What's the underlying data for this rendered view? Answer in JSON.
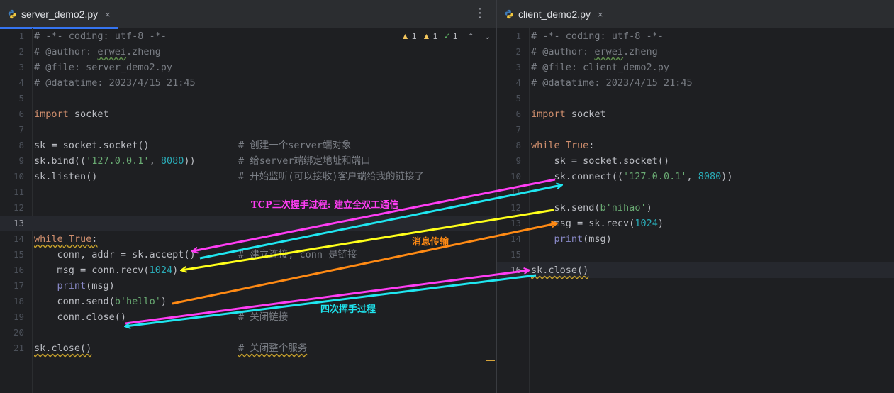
{
  "left_tab": {
    "label": "server_demo2.py",
    "close": "×"
  },
  "right_tab": {
    "label": "client_demo2.py",
    "close": "×"
  },
  "kebab": "⋮",
  "inspections": {
    "warnings": "1",
    "weak_warnings": "1",
    "typos": "1"
  },
  "left_lines": [
    {
      "n": "1",
      "html": "<span class=\"c-com\"># -*- coding: utf-8 -*-</span>"
    },
    {
      "n": "2",
      "html": "<span class=\"c-com\"># @author: <span class=\"squig-green\">erwei</span>.zheng</span>"
    },
    {
      "n": "3",
      "html": "<span class=\"c-com\"># @file: server_demo2.py</span>"
    },
    {
      "n": "4",
      "html": "<span class=\"c-com\"># @datatime: 2023/4/15 21:45</span>"
    },
    {
      "n": "5",
      "html": ""
    },
    {
      "n": "6",
      "html": "<span class=\"c-kw\">import</span> socket"
    },
    {
      "n": "7",
      "html": ""
    },
    {
      "n": "8",
      "html": "sk = socket.socket()",
      "comment": "# 创建一个server端对象"
    },
    {
      "n": "9",
      "html": "sk.bind((<span class=\"c-str\">'127.0.0.1'</span>, <span class=\"c-num\">8080</span>))",
      "comment": "# 给server端绑定地址和端口"
    },
    {
      "n": "10",
      "html": "sk.listen()",
      "comment": "# 开始监听(可以接收)客户端给我的链接了"
    },
    {
      "n": "11",
      "html": ""
    },
    {
      "n": "12",
      "html": ""
    },
    {
      "n": "13",
      "html": "",
      "current": true
    },
    {
      "n": "14",
      "html": "<span class=\"squig-yellow\"><span class=\"c-kw\">while</span> <span class=\"c-kw\">True</span>:</span>"
    },
    {
      "n": "15",
      "html": "    conn, addr = sk.accept()",
      "comment": "# 建立连接, conn 是链接"
    },
    {
      "n": "16",
      "html": "    msg = conn.recv(<span class=\"c-num\">1024</span>)"
    },
    {
      "n": "17",
      "html": "    <span class=\"c-builtin\">print</span>(msg)"
    },
    {
      "n": "18",
      "html": "    conn.send(<span class=\"c-str\">b'hello'</span>)"
    },
    {
      "n": "19",
      "html": "    conn.close()",
      "comment": "# 关闭链接"
    },
    {
      "n": "20",
      "html": ""
    },
    {
      "n": "21",
      "html": "<span class=\"squig-yellow\">sk.close()</span>",
      "comment": "<span class=\"squig-yellow\"># 关闭整个服务</span>"
    }
  ],
  "right_lines": [
    {
      "n": "1",
      "html": "<span class=\"c-com\"># -*- coding: utf-8 -*-</span>"
    },
    {
      "n": "2",
      "html": "<span class=\"c-com\"># @author: <span class=\"squig-green\">erwei</span>.zheng</span>"
    },
    {
      "n": "3",
      "html": "<span class=\"c-com\"># @file: client_demo2.py</span>"
    },
    {
      "n": "4",
      "html": "<span class=\"c-com\"># @datatime: 2023/4/15 21:45</span>"
    },
    {
      "n": "5",
      "html": ""
    },
    {
      "n": "6",
      "html": "<span class=\"c-kw\">import</span> socket"
    },
    {
      "n": "7",
      "html": ""
    },
    {
      "n": "8",
      "html": "<span class=\"c-kw\">while</span> <span class=\"c-kw\">True</span>:"
    },
    {
      "n": "9",
      "html": "    sk = socket.socket()"
    },
    {
      "n": "10",
      "html": "    sk.connect((<span class=\"c-str\">'127.0.0.1'</span>, <span class=\"c-num\">8080</span>))"
    },
    {
      "n": "11",
      "html": ""
    },
    {
      "n": "12",
      "html": "    sk.send(<span class=\"c-str\">b'nihao'</span>)"
    },
    {
      "n": "13",
      "html": "    msg = sk.recv(<span class=\"c-num\">1024</span>)"
    },
    {
      "n": "14",
      "html": "    <span class=\"c-builtin\">print</span>(msg)"
    },
    {
      "n": "15",
      "html": ""
    },
    {
      "n": "16",
      "html": "<span class=\"squig-yellow\">sk.close()</span>",
      "current": true
    }
  ],
  "annotations": {
    "handshake": "TCP三次握手过程: 建立全双工通信",
    "transfer": "消息传输",
    "wave": "四次挥手过程"
  },
  "colors": {
    "magenta": "#ff3df4",
    "cyan": "#1fe6f0",
    "yellow": "#ffff1a",
    "orange": "#ff8a14",
    "handshake_text": "#ff3df4",
    "transfer_text": "#ff8a14",
    "wave_text": "#1fe6f0"
  }
}
